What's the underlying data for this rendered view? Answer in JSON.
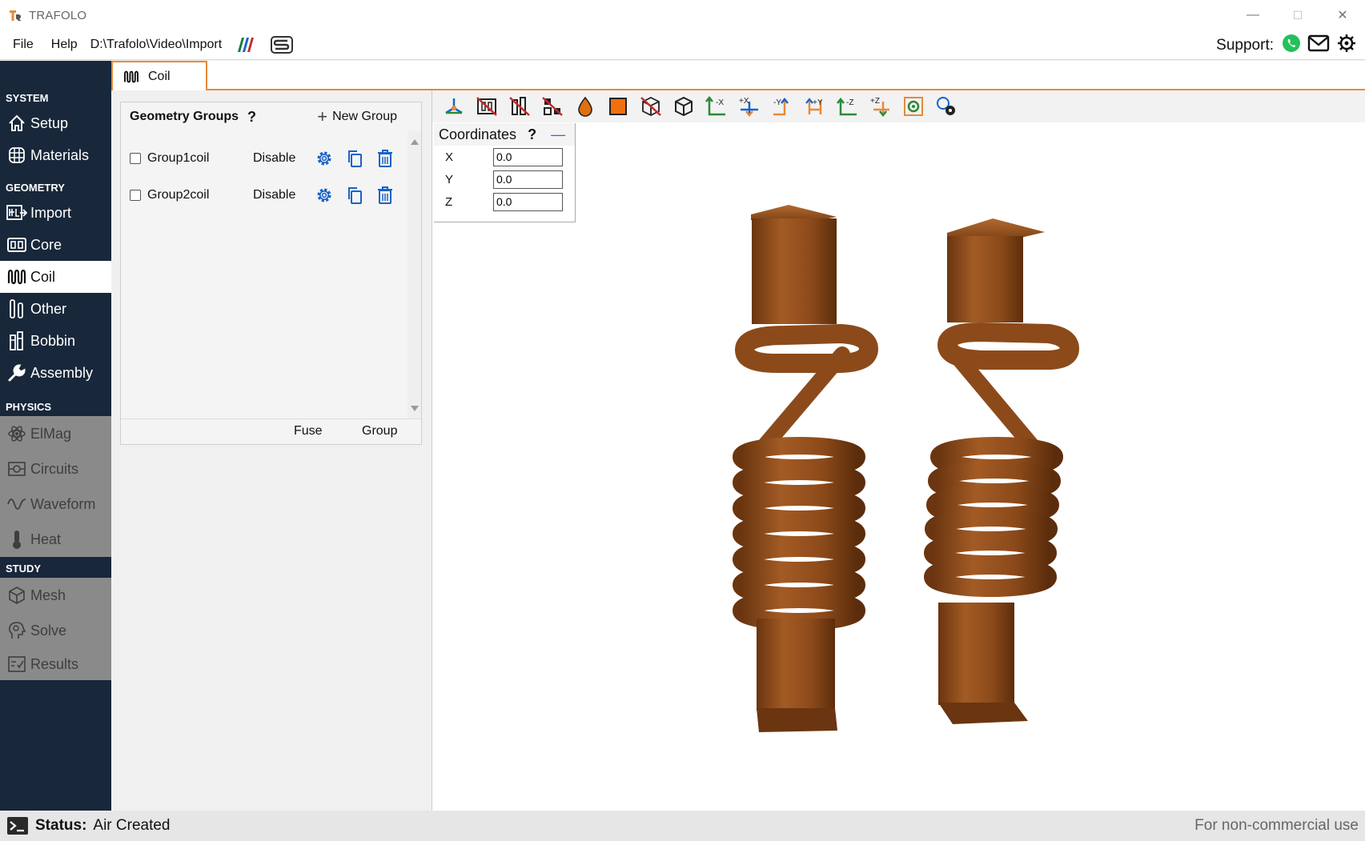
{
  "app": {
    "title": "TRAFOLO"
  },
  "window_controls": {
    "minimize": "—",
    "maximize": "☐",
    "close": "✕"
  },
  "menubar": {
    "file": "File",
    "help": "Help",
    "path": "D:\\Trafolo\\Video\\Import",
    "support_label": "Support:"
  },
  "sidebar": {
    "sections": {
      "system": "SYSTEM",
      "geometry": "GEOMETRY",
      "physics": "PHYSICS",
      "study": "STUDY"
    },
    "items": {
      "setup": "Setup",
      "materials": "Materials",
      "import": "Import",
      "core": "Core",
      "coil": "Coil",
      "other": "Other",
      "bobbin": "Bobbin",
      "assembly": "Assembly",
      "elmag": "ElMag",
      "circuits": "Circuits",
      "waveform": "Waveform",
      "heat": "Heat",
      "mesh": "Mesh",
      "solve": "Solve",
      "results": "Results"
    }
  },
  "tab": {
    "label": "Coil"
  },
  "groups_panel": {
    "title": "Geometry Groups",
    "help": "?",
    "new_group": "New Group",
    "rows": [
      {
        "name": "Group1coil",
        "disable": "Disable"
      },
      {
        "name": "Group2coil",
        "disable": "Disable"
      }
    ],
    "footer": {
      "fuse": "Fuse",
      "group": "Group"
    }
  },
  "toolbar": {
    "buttons": [
      "axes-icon",
      "hide-core-icon",
      "hide-bobbin-icon",
      "hide-other-icon",
      "material-drop-icon",
      "solid-view-icon",
      "wireframe-icon",
      "cube-view-icon",
      "view-neg-x-icon",
      "view-pos-x-icon",
      "view-neg-y-icon",
      "view-pos-y-icon",
      "view-neg-z-icon",
      "view-pos-z-icon",
      "fit-view-icon",
      "settings-view-icon"
    ],
    "axis_labels": {
      "negx": "-X",
      "posx": "+X",
      "negy": "-Y",
      "posy": "+Y",
      "negz": "-Z",
      "posz": "+Z"
    }
  },
  "coordinates": {
    "title": "Coordinates",
    "help": "?",
    "minimize": "—",
    "x_label": "X",
    "x_value": "0.0",
    "y_label": "Y",
    "y_value": "0.0",
    "z_label": "Z",
    "z_value": "0.0"
  },
  "status": {
    "label": "Status:",
    "value": "Air Created",
    "license": "For non-commercial use"
  },
  "colors": {
    "sidebar_bg": "#18273a",
    "accent_orange": "#e8893a",
    "icon_blue": "#1a62c7",
    "copper": "#8b4a1c"
  }
}
